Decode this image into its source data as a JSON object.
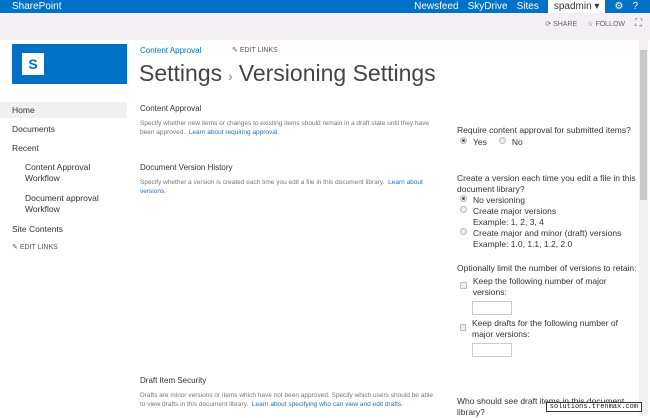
{
  "topbar": {
    "brand": "SharePoint",
    "nav": [
      "Newsfeed",
      "SkyDrive",
      "Sites"
    ],
    "user": "spadmin ▾",
    "settings_icon": "gear-icon",
    "help": "?"
  },
  "suitebar": {
    "share": "SHARE",
    "follow": "FOLLOW"
  },
  "header": {
    "breadcrumb": "Content Approval",
    "edit_links": "EDIT LINKS",
    "title_parent": "Settings",
    "title_sep": "›",
    "title": "Versioning Settings"
  },
  "leftnav": {
    "items": [
      "Home",
      "Documents",
      "Recent"
    ],
    "recent": [
      "Content Approval Workflow",
      "Document approval Workflow"
    ],
    "site_contents": "Site Contents",
    "edit_links": "EDIT LINKS"
  },
  "sections": {
    "approval": {
      "title": "Content Approval",
      "desc": "Specify whether new items or changes to existing items should remain in a draft state until they have been approved.",
      "link": "Learn about requiring approval."
    },
    "history": {
      "title": "Document Version History",
      "desc": "Specify whether a version is created each time you edit a file in this document library.",
      "link": "Learn about versions."
    },
    "drafts": {
      "title": "Draft Item Security",
      "desc": "Drafts are minor versions or items which have not been approved. Specify which users should be able to view drafts in this document library.",
      "link": "Learn about specifying who can view and edit drafts."
    }
  },
  "form": {
    "approval_q": "Require content approval for submitted items?",
    "yes": "Yes",
    "no": "No",
    "version_q": "Create a version each time you edit a file in this document library?",
    "no_versioning": "No versioning",
    "major": "Create major versions",
    "major_ex": "Example: 1, 2, 3, 4",
    "minor": "Create major and minor (draft) versions",
    "minor_ex": "Example: 1.0, 1.1, 1.2, 2.0",
    "limit_q": "Optionally limit the number of versions to retain:",
    "keep_major": "Keep the following number of major versions:",
    "keep_drafts": "Keep drafts for the following number of major versions:",
    "draft_q": "Who should see draft items in this document library?"
  },
  "watermark": "solutions.trenmax.com"
}
